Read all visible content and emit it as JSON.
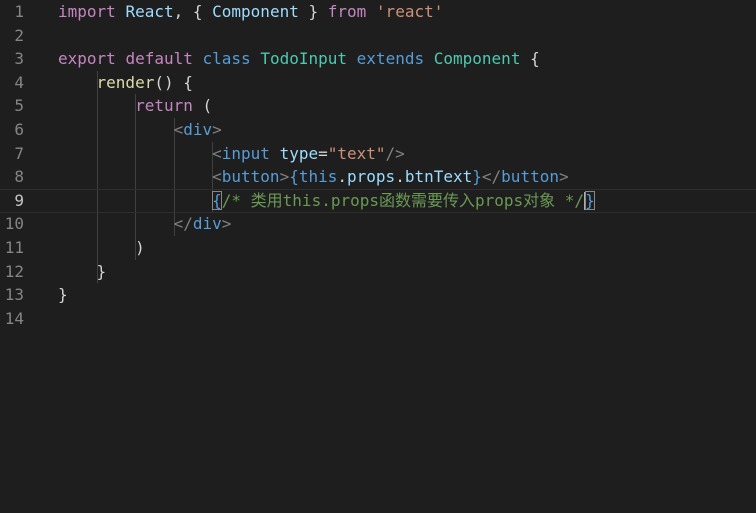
{
  "editor": {
    "language": "javascript",
    "line_numbers": [
      "1",
      "2",
      "3",
      "4",
      "5",
      "6",
      "7",
      "8",
      "9",
      "10",
      "11",
      "12",
      "13",
      "14"
    ],
    "current_line": 9,
    "lines": [
      [
        {
          "t": "import",
          "c": "kw"
        },
        {
          "t": " ",
          "c": "pl"
        },
        {
          "t": "React",
          "c": "id"
        },
        {
          "t": ", { ",
          "c": "pl"
        },
        {
          "t": "Component",
          "c": "id"
        },
        {
          "t": " } ",
          "c": "pl"
        },
        {
          "t": "from",
          "c": "kw"
        },
        {
          "t": " ",
          "c": "pl"
        },
        {
          "t": "'react'",
          "c": "str"
        }
      ],
      [],
      [
        {
          "t": "export",
          "c": "kw"
        },
        {
          "t": " ",
          "c": "pl"
        },
        {
          "t": "default",
          "c": "kw"
        },
        {
          "t": " ",
          "c": "pl"
        },
        {
          "t": "class",
          "c": "st"
        },
        {
          "t": " ",
          "c": "pl"
        },
        {
          "t": "TodoInput",
          "c": "cls"
        },
        {
          "t": " ",
          "c": "pl"
        },
        {
          "t": "extends",
          "c": "st"
        },
        {
          "t": " ",
          "c": "pl"
        },
        {
          "t": "Component",
          "c": "cls"
        },
        {
          "t": " {",
          "c": "pl"
        }
      ],
      [
        {
          "t": "    ",
          "c": "pl"
        },
        {
          "t": "render",
          "c": "fn"
        },
        {
          "t": "() {",
          "c": "pl"
        }
      ],
      [
        {
          "t": "        ",
          "c": "pl"
        },
        {
          "t": "return",
          "c": "kw"
        },
        {
          "t": " (",
          "c": "pl"
        }
      ],
      [
        {
          "t": "            ",
          "c": "pl"
        },
        {
          "t": "<",
          "c": "br"
        },
        {
          "t": "div",
          "c": "tag"
        },
        {
          "t": ">",
          "c": "br"
        }
      ],
      [
        {
          "t": "                ",
          "c": "pl"
        },
        {
          "t": "<",
          "c": "br"
        },
        {
          "t": "input",
          "c": "tag"
        },
        {
          "t": " ",
          "c": "pl"
        },
        {
          "t": "type",
          "c": "attr"
        },
        {
          "t": "=",
          "c": "pl"
        },
        {
          "t": "\"text\"",
          "c": "str"
        },
        {
          "t": "/>",
          "c": "br"
        }
      ],
      [
        {
          "t": "                ",
          "c": "pl"
        },
        {
          "t": "<",
          "c": "br"
        },
        {
          "t": "button",
          "c": "tag"
        },
        {
          "t": ">",
          "c": "br"
        },
        {
          "t": "{",
          "c": "st"
        },
        {
          "t": "this",
          "c": "st"
        },
        {
          "t": ".",
          "c": "pl"
        },
        {
          "t": "props",
          "c": "id"
        },
        {
          "t": ".",
          "c": "pl"
        },
        {
          "t": "btnText",
          "c": "id"
        },
        {
          "t": "}",
          "c": "st"
        },
        {
          "t": "</",
          "c": "br"
        },
        {
          "t": "button",
          "c": "tag"
        },
        {
          "t": ">",
          "c": "br"
        }
      ],
      [
        {
          "t": "                ",
          "c": "pl"
        },
        {
          "t": "{",
          "c": "st",
          "m": true
        },
        {
          "t": "/* 类用this.props函数需要传入props对象 */",
          "c": "cm"
        },
        {
          "t": "",
          "c": "cursor"
        },
        {
          "t": "}",
          "c": "st",
          "m": true
        }
      ],
      [
        {
          "t": "            ",
          "c": "pl"
        },
        {
          "t": "</",
          "c": "br"
        },
        {
          "t": "div",
          "c": "tag"
        },
        {
          "t": ">",
          "c": "br"
        }
      ],
      [
        {
          "t": "        )",
          "c": "pl"
        }
      ],
      [
        {
          "t": "    }",
          "c": "pl"
        }
      ],
      [
        {
          "t": "}",
          "c": "pl"
        }
      ],
      []
    ]
  }
}
